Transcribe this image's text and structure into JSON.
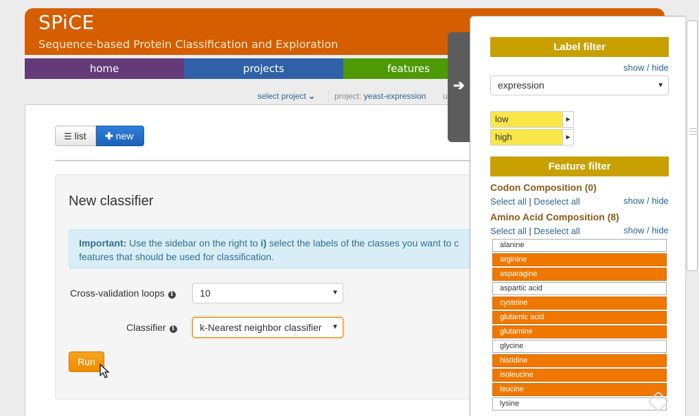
{
  "app": {
    "title": "SPiCE",
    "subtitle": "Sequence-based Protein Classification and Exploration"
  },
  "nav": [
    {
      "label": "home",
      "color": "#653a79"
    },
    {
      "label": "projects",
      "color": "#3061a8"
    },
    {
      "label": "features",
      "color": "#4e9a06"
    }
  ],
  "subbar": {
    "select_project": "select project",
    "project_prefix": "project:",
    "project_name": "yeast-expression",
    "user_cut": "u"
  },
  "buttons": {
    "list": "list",
    "new": "new",
    "run": "Run"
  },
  "classifier_panel": {
    "title": "New classifier",
    "alert_important": "Important:",
    "alert_text1": " Use the sidebar on the right to ",
    "alert_i": "i)",
    "alert_text2": " select the labels of the classes you want to c",
    "alert_line2": "features that should be used for classification.",
    "cv_label": "Cross-validation loops",
    "cv_value": "10",
    "classifier_label": "Classifier",
    "classifier_value": "k-Nearest neighbor classifier"
  },
  "sidebar": {
    "label_filter": "Label filter",
    "show": "show",
    "sep": " / ",
    "hide": "hide",
    "label_select": "expression",
    "labels": [
      "low",
      "high"
    ],
    "feature_filter": "Feature filter",
    "select_all": "Select all",
    "pipe": "|",
    "deselect_all": "Deselect all",
    "categories": [
      {
        "title": "Codon Composition (0)"
      },
      {
        "title": "Amino Acid Composition (8)"
      }
    ],
    "features": [
      {
        "name": "alanine",
        "selected": false
      },
      {
        "name": "arginine",
        "selected": true
      },
      {
        "name": "asparagine",
        "selected": true
      },
      {
        "name": "aspartic acid",
        "selected": false
      },
      {
        "name": "cysteine",
        "selected": true
      },
      {
        "name": "glutamic acid",
        "selected": true
      },
      {
        "name": "glutamine",
        "selected": true
      },
      {
        "name": "glycine",
        "selected": false
      },
      {
        "name": "histidine",
        "selected": true
      },
      {
        "name": "isoleucine",
        "selected": true
      },
      {
        "name": "leucine",
        "selected": true
      },
      {
        "name": "lysine",
        "selected": false
      }
    ]
  },
  "colors": {
    "banner": "#d45e00",
    "accent": "#c8a000",
    "selected_feature": "#f07800"
  }
}
